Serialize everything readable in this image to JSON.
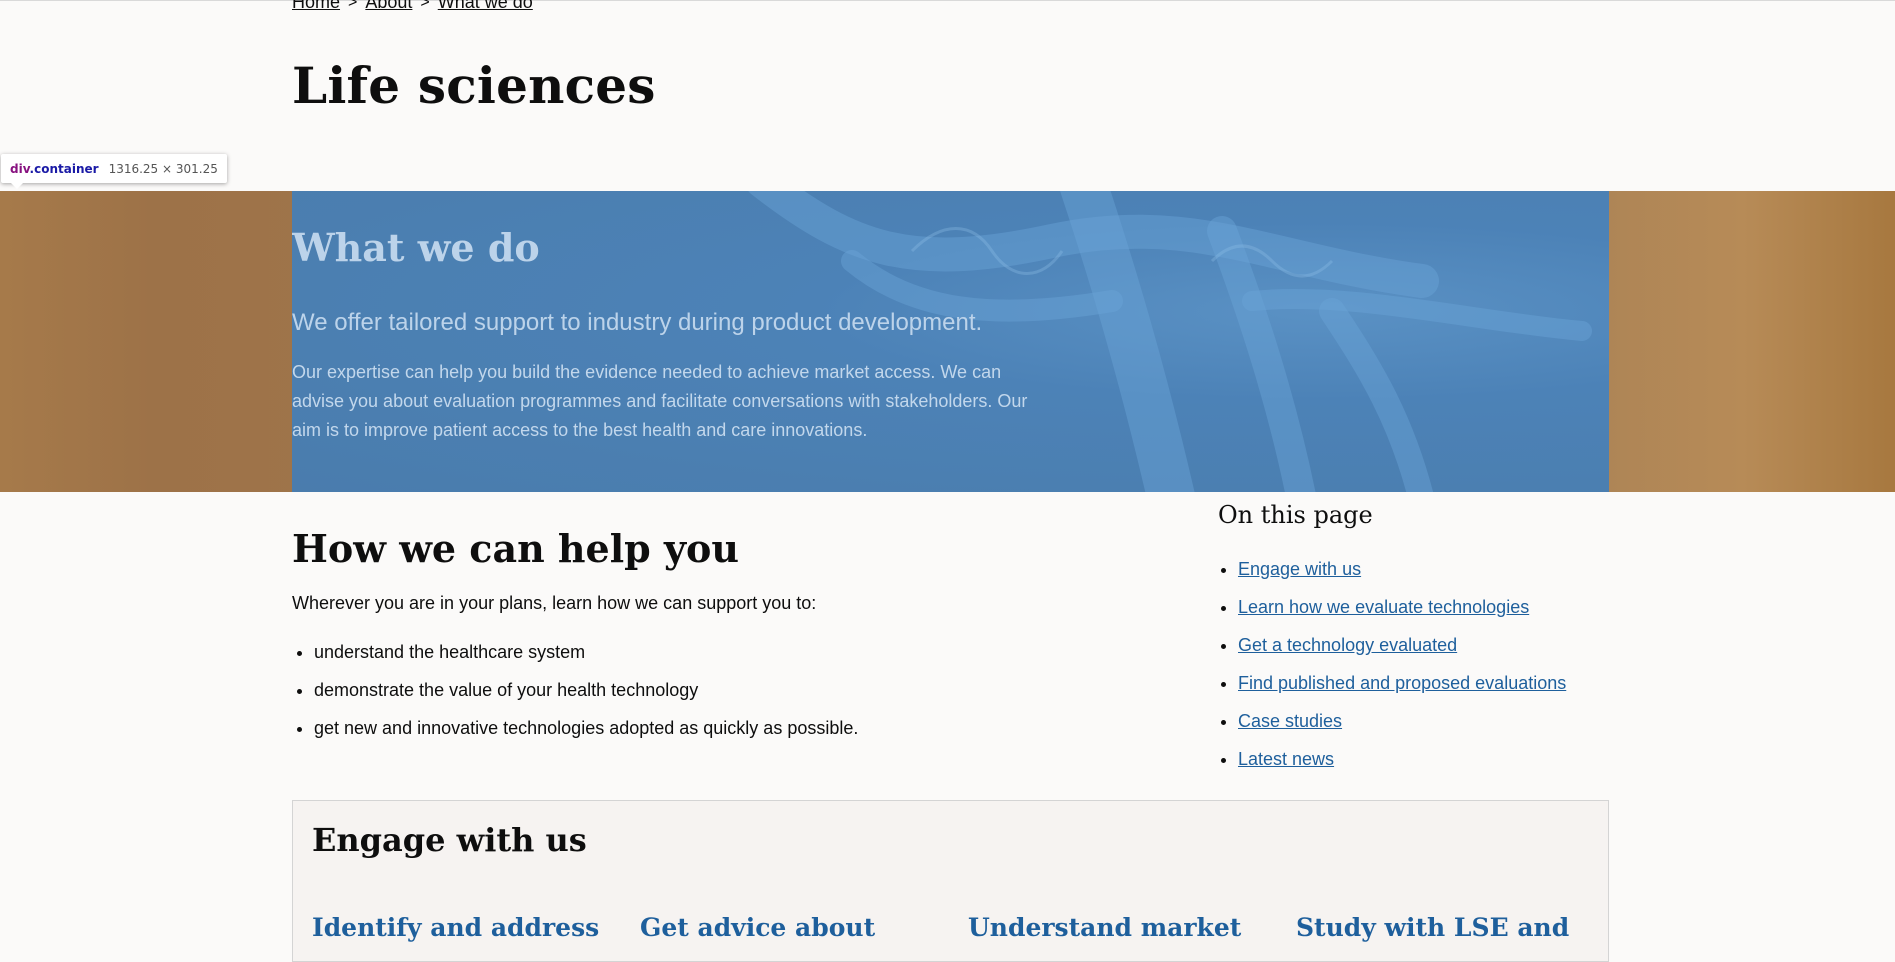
{
  "breadcrumb": {
    "items": [
      "Home",
      "About",
      "What we do"
    ],
    "separator": ">"
  },
  "page": {
    "title": "Life sciences"
  },
  "devtools": {
    "tag": "div",
    "class": ".container",
    "dimensions": "1316.25 × 301.25"
  },
  "hero": {
    "heading": "What we do",
    "lead": "We offer tailored support to industry during product development.",
    "body": "Our expertise can help you build the evidence needed to achieve market access. We can advise you about evaluation programmes and facilitate conversations with stakeholders. Our aim is to improve patient access to the best health and care innovations."
  },
  "help": {
    "heading": "How we can help you",
    "intro": "Wherever you are in your plans, learn how we can support you to:",
    "items": [
      "understand the healthcare system",
      "demonstrate the value of your health technology",
      "get new and innovative technologies adopted as quickly as possible."
    ]
  },
  "on_this_page": {
    "heading": "On this page",
    "links": [
      "Engage with us",
      "Learn how we evaluate technologies",
      "Get a technology evaluated",
      "Find published and proposed evaluations",
      "Case studies",
      "Latest news"
    ]
  },
  "engage": {
    "heading": "Engage with us",
    "cards": [
      "Identify and address",
      "Get advice about",
      "Understand market",
      "Study with LSE and"
    ]
  },
  "colors": {
    "page_bg": "#fbfaf9",
    "hero_panel": "#4b7fb1",
    "hero_side": "#a67a4a",
    "link": "#1e5f9c",
    "engage_bg": "#f6f3f1"
  }
}
